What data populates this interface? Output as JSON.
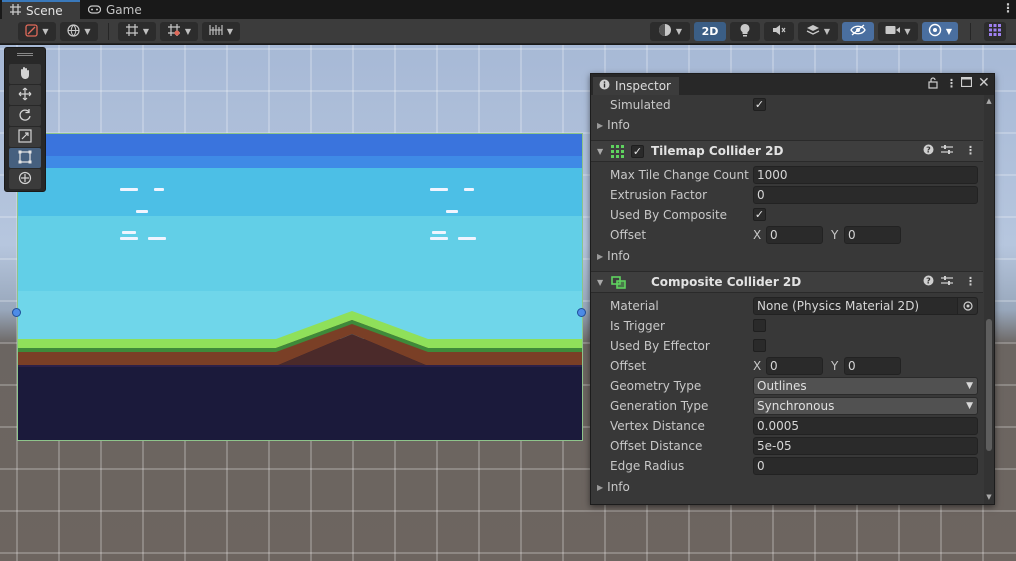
{
  "tabs": {
    "scene_label": "Scene",
    "game_label": "Game",
    "more": "⋮"
  },
  "toolbar": {
    "mode_2d_label": "2D",
    "icons": [
      "gizmo-draw-mode-icon",
      "global-local-icon",
      "grid-snap-icon",
      "grid-visibility-icon",
      "increment-snap-icon",
      "shading-mode-icon",
      "lighting-icon",
      "audio-mute-icon",
      "effects-icon",
      "scene-visibility-icon",
      "camera-icon",
      "gizmos-icon",
      "overlay-icon"
    ]
  },
  "inspector": {
    "title": "Inspector",
    "simulated_label": "Simulated",
    "info_label": "Info",
    "tilemap": {
      "title": "Tilemap Collider 2D",
      "max_tile_change_count_label": "Max Tile Change Count",
      "max_tile_change_count_value": "1000",
      "extrusion_factor_label": "Extrusion Factor",
      "extrusion_factor_value": "0",
      "used_by_composite_label": "Used By Composite",
      "offset_label": "Offset",
      "offset_x_label": "X",
      "offset_x_value": "0",
      "offset_y_label": "Y",
      "offset_y_value": "0",
      "info_label": "Info"
    },
    "composite": {
      "title": "Composite Collider 2D",
      "material_label": "Material",
      "material_value": "None (Physics Material 2D)",
      "is_trigger_label": "Is Trigger",
      "used_by_effector_label": "Used By Effector",
      "offset_label": "Offset",
      "offset_x_label": "X",
      "offset_x_value": "0",
      "offset_y_label": "Y",
      "offset_y_value": "0",
      "geometry_type_label": "Geometry Type",
      "geometry_type_value": "Outlines",
      "generation_type_label": "Generation Type",
      "generation_type_value": "Synchronous",
      "vertex_distance_label": "Vertex Distance",
      "vertex_distance_value": "0.0005",
      "offset_distance_label": "Offset Distance",
      "offset_distance_value": "5e-05",
      "edge_radius_label": "Edge Radius",
      "edge_radius_value": "0",
      "info_label": "Info"
    }
  },
  "colors": {
    "accent_blue": "#3a79bb",
    "tilemap_icon": "#5fd35f",
    "grass": "#7ed957",
    "dirt": "#7a3f26",
    "underground": "#1a1838",
    "sky_top": "#3d7be0",
    "sky_mid": "#5fd0e6"
  }
}
